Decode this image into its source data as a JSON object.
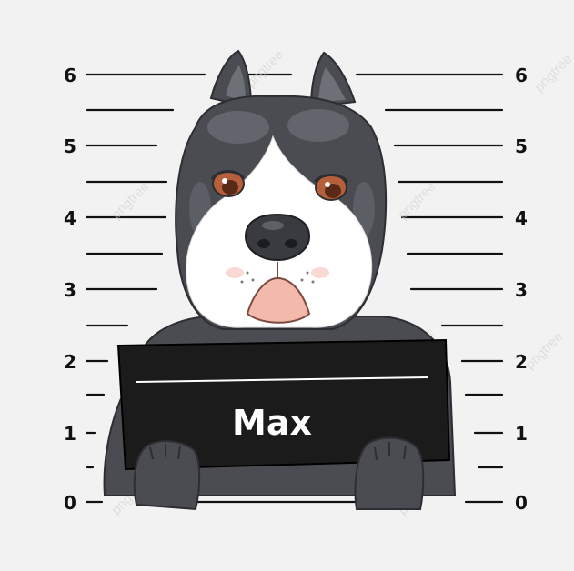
{
  "height_chart": {
    "left_labels": [
      "6",
      "5",
      "4",
      "3",
      "2",
      "1",
      "0"
    ],
    "right_labels": [
      "6",
      "5",
      "4",
      "3",
      "2",
      "1",
      "0"
    ]
  },
  "sign": {
    "name": "Max"
  },
  "watermark": {
    "text": "pngtree"
  },
  "colors": {
    "background": "#f2f2f2",
    "dog_fur": "#4a4c52",
    "dog_fur_light": "#6d7077",
    "dog_white": "#ffffff",
    "sign_board": "#1b1b1b",
    "nose": "#3a3b40",
    "mouth": "#f3b9aa",
    "eyes": "#b5603a"
  }
}
